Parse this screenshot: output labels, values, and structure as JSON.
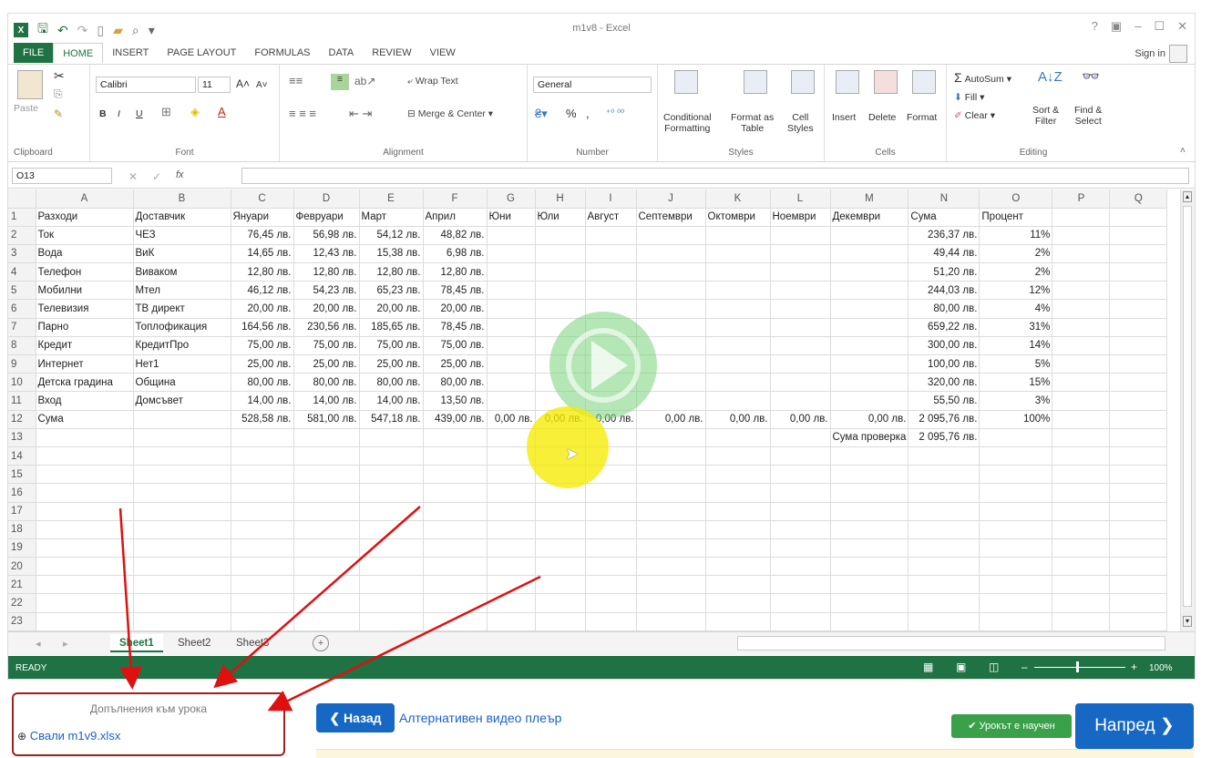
{
  "excel": {
    "window_title": "m1v8 - Excel",
    "window_controls": [
      "?",
      "▣",
      "–",
      "☐",
      "✕"
    ],
    "sign_in": "Sign in",
    "tabs": [
      "FILE",
      "HOME",
      "INSERT",
      "PAGE LAYOUT",
      "FORMULAS",
      "DATA",
      "REVIEW",
      "VIEW"
    ],
    "active_tab": "HOME",
    "ribbon": {
      "clipboard": {
        "paste": "Paste",
        "label": "Clipboard"
      },
      "font": {
        "name": "Calibri",
        "size": "11",
        "label": "Font",
        "bold": "B",
        "italic": "I",
        "underline": "U"
      },
      "alignment": {
        "wrap": "Wrap Text",
        "merge": "Merge & Center",
        "label": "Alignment"
      },
      "number": {
        "format": "General",
        "percent": "%",
        "comma": ",",
        "label": "Number"
      },
      "styles": {
        "conditional": "Conditional\nFormatting",
        "format_table": "Format as\nTable",
        "cell_styles": "Cell\nStyles",
        "label": "Styles"
      },
      "cells": {
        "insert": "Insert",
        "delete": "Delete",
        "format": "Format",
        "label": "Cells"
      },
      "editing": {
        "autosum": "AutoSum",
        "fill": "Fill",
        "clear": "Clear",
        "sort": "Sort &\nFilter",
        "find": "Find &\nSelect",
        "label": "Editing"
      }
    },
    "name_box": "O13",
    "formula_symbol": "fx",
    "columns": [
      "A",
      "B",
      "C",
      "D",
      "E",
      "F",
      "G",
      "H",
      "I",
      "J",
      "K",
      "L",
      "M",
      "N",
      "O",
      "P",
      "Q"
    ],
    "rows": [
      [
        "1",
        "Разходи",
        "Доставчик",
        "Януари",
        "Февруари",
        "Март",
        "Април",
        "Юни",
        "Юли",
        "Август",
        "Септември",
        "Октомври",
        "Ноември",
        "Декември",
        "Сума",
        "Процент",
        "",
        ""
      ],
      [
        "2",
        "Ток",
        "ЧЕЗ",
        "76,45 лв.",
        "56,98 лв.",
        "54,12 лв.",
        "48,82 лв.",
        "",
        "",
        "",
        "",
        "",
        "",
        "",
        "236,37 лв.",
        "11%",
        "",
        ""
      ],
      [
        "3",
        "Вода",
        "ВиК",
        "14,65 лв.",
        "12,43 лв.",
        "15,38 лв.",
        "6,98 лв.",
        "",
        "",
        "",
        "",
        "",
        "",
        "",
        "49,44 лв.",
        "2%",
        "",
        ""
      ],
      [
        "4",
        "Телефон",
        "Виваком",
        "12,80 лв.",
        "12,80 лв.",
        "12,80 лв.",
        "12,80 лв.",
        "",
        "",
        "",
        "",
        "",
        "",
        "",
        "51,20 лв.",
        "2%",
        "",
        ""
      ],
      [
        "5",
        "Мобилни",
        "Мтел",
        "46,12 лв.",
        "54,23 лв.",
        "65,23 лв.",
        "78,45 лв.",
        "",
        "",
        "",
        "",
        "",
        "",
        "",
        "244,03 лв.",
        "12%",
        "",
        ""
      ],
      [
        "6",
        "Телевизия",
        "ТВ директ",
        "20,00 лв.",
        "20,00 лв.",
        "20,00 лв.",
        "20,00 лв.",
        "",
        "",
        "",
        "",
        "",
        "",
        "",
        "80,00 лв.",
        "4%",
        "",
        ""
      ],
      [
        "7",
        "Парно",
        "Топлофикация",
        "164,56 лв.",
        "230,56 лв.",
        "185,65 лв.",
        "78,45 лв.",
        "",
        "",
        "",
        "",
        "",
        "",
        "",
        "659,22 лв.",
        "31%",
        "",
        ""
      ],
      [
        "8",
        "Кредит",
        "КредитПро",
        "75,00 лв.",
        "75,00 лв.",
        "75,00 лв.",
        "75,00 лв.",
        "",
        "",
        "",
        "",
        "",
        "",
        "",
        "300,00 лв.",
        "14%",
        "",
        ""
      ],
      [
        "9",
        "Интернет",
        "Нет1",
        "25,00 лв.",
        "25,00 лв.",
        "25,00 лв.",
        "25,00 лв.",
        "",
        "",
        "",
        "",
        "",
        "",
        "",
        "100,00 лв.",
        "5%",
        "",
        ""
      ],
      [
        "10",
        "Детска градина",
        "Община",
        "80,00 лв.",
        "80,00 лв.",
        "80,00 лв.",
        "80,00 лв.",
        "",
        "",
        "",
        "",
        "",
        "",
        "",
        "320,00 лв.",
        "15%",
        "",
        ""
      ],
      [
        "11",
        "Вход",
        "Домсъвет",
        "14,00 лв.",
        "14,00 лв.",
        "14,00 лв.",
        "13,50 лв.",
        "",
        "",
        "",
        "",
        "",
        "",
        "",
        "55,50 лв.",
        "3%",
        "",
        ""
      ],
      [
        "12",
        "Сума",
        "",
        "528,58 лв.",
        "581,00 лв.",
        "547,18 лв.",
        "439,00 лв.",
        "0,00 лв.",
        "0,00 лв.",
        "0,00 лв.",
        "0,00 лв.",
        "0,00 лв.",
        "0,00 лв.",
        "0,00 лв.",
        "2 095,76 лв.",
        "100%",
        "",
        ""
      ],
      [
        "13",
        "",
        "",
        "",
        "",
        "",
        "",
        "",
        "",
        "",
        "",
        "",
        "",
        "Сума проверка",
        "2 095,76 лв.",
        "",
        "",
        ""
      ],
      [
        "14",
        "",
        "",
        "",
        "",
        "",
        "",
        "",
        "",
        "",
        "",
        "",
        "",
        "",
        "",
        "",
        "",
        ""
      ],
      [
        "15",
        "",
        "",
        "",
        "",
        "",
        "",
        "",
        "",
        "",
        "",
        "",
        "",
        "",
        "",
        "",
        "",
        ""
      ],
      [
        "16",
        "",
        "",
        "",
        "",
        "",
        "",
        "",
        "",
        "",
        "",
        "",
        "",
        "",
        "",
        "",
        "",
        ""
      ],
      [
        "17",
        "",
        "",
        "",
        "",
        "",
        "",
        "",
        "",
        "",
        "",
        "",
        "",
        "",
        "",
        "",
        "",
        ""
      ],
      [
        "18",
        "",
        "",
        "",
        "",
        "",
        "",
        "",
        "",
        "",
        "",
        "",
        "",
        "",
        "",
        "",
        "",
        ""
      ],
      [
        "19",
        "",
        "",
        "",
        "",
        "",
        "",
        "",
        "",
        "",
        "",
        "",
        "",
        "",
        "",
        "",
        "",
        ""
      ],
      [
        "20",
        "",
        "",
        "",
        "",
        "",
        "",
        "",
        "",
        "",
        "",
        "",
        "",
        "",
        "",
        "",
        "",
        ""
      ],
      [
        "21",
        "",
        "",
        "",
        "",
        "",
        "",
        "",
        "",
        "",
        "",
        "",
        "",
        "",
        "",
        "",
        "",
        ""
      ],
      [
        "22",
        "",
        "",
        "",
        "",
        "",
        "",
        "",
        "",
        "",
        "",
        "",
        "",
        "",
        "",
        "",
        "",
        ""
      ],
      [
        "23",
        "",
        "",
        "",
        "",
        "",
        "",
        "",
        "",
        "",
        "",
        "",
        "",
        "",
        "",
        "",
        "",
        ""
      ]
    ],
    "sheets": [
      "Sheet1",
      "Sheet2",
      "Sheet3"
    ],
    "active_sheet": "Sheet1",
    "status": "READY",
    "zoom": "100%"
  },
  "lesson": {
    "addons_title": "Допълнения към урока",
    "download_link": "Свали m1v9.xlsx",
    "back_button": "Назад",
    "alt_player_link": "Алтернативен видео плеър",
    "learned_button": "Урокът е научен",
    "next_button": "Напред"
  },
  "colors": {
    "excel_green": "#1f7244",
    "link_blue": "#1a62c9",
    "button_blue": "#1668c4",
    "annotation_red": "#e01010",
    "highlight_yellow": "#f5eb00"
  }
}
